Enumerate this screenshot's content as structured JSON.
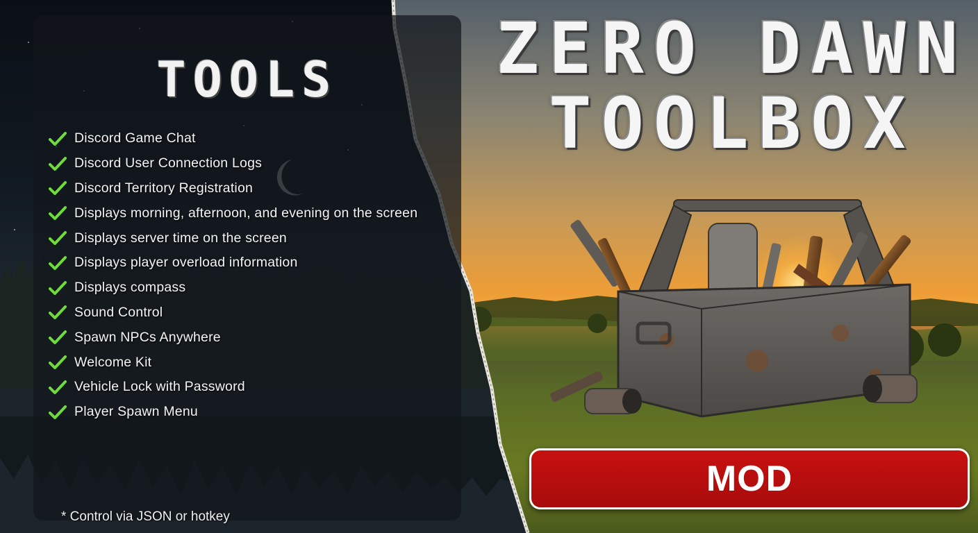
{
  "panel": {
    "title": "TOOLS",
    "items": [
      "Discord Game Chat",
      "Discord User Connection Logs",
      "Discord Territory Registration",
      "Displays morning, afternoon, and evening on the screen",
      "Displays server time on the screen",
      "Displays player overload information",
      "Displays compass",
      "Sound Control",
      "Spawn NPCs Anywhere",
      "Welcome Kit",
      "Vehicle Lock with Password",
      "Player Spawn Menu"
    ],
    "footnote": "* Control via JSON or hotkey",
    "check_icon": "check-icon",
    "check_color": "#6fdc3c"
  },
  "hero": {
    "title_line1": "ZERO DAWN",
    "title_line2": "TOOLBOX",
    "image_icon": "toolbox-icon"
  },
  "cta": {
    "label": "MOD",
    "color": "#b30e0e"
  }
}
